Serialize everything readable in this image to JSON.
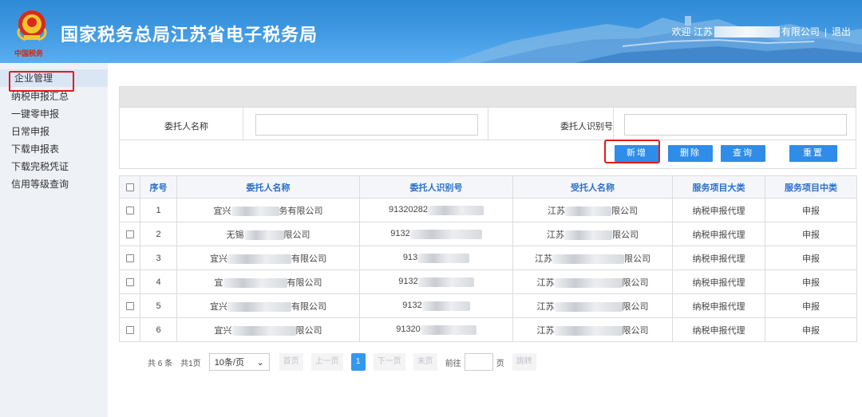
{
  "header": {
    "site_title": "国家税务总局江苏省电子税务局",
    "logo_caption": "中国税务",
    "welcome_prefix": "欢迎 江苏",
    "welcome_suffix": "有限公司",
    "separator": "|",
    "logout_label": "退出",
    "colors": {
      "header_bg": "#3e97e0",
      "accent": "#2f8ce8",
      "highlight": "#e31a1a"
    }
  },
  "sidebar": {
    "items": [
      {
        "label": "企业管理",
        "active": true
      },
      {
        "label": "纳税申报汇总"
      },
      {
        "label": "一键零申报"
      },
      {
        "label": "日常申报"
      },
      {
        "label": "下载申报表"
      },
      {
        "label": "下载完税凭证"
      },
      {
        "label": "信用等级查询"
      }
    ]
  },
  "search": {
    "field1_label": "委托人名称",
    "field1_value": "",
    "field2_label": "委托人识别号",
    "field2_value": ""
  },
  "actions": {
    "add_label": "新增",
    "delete_label": "删除",
    "query_label": "查询",
    "reset_label": "重置"
  },
  "table": {
    "headers": [
      "",
      "序号",
      "委托人名称",
      "委托人识别号",
      "受托人名称",
      "服务项目大类",
      "服务项目中类"
    ],
    "rows": [
      {
        "index": "1",
        "client_pre": "宜兴",
        "client_suf": "务有限公司",
        "id_pre": "91320282",
        "id_suf": "",
        "agent_pre": "江苏",
        "agent_suf": "限公司",
        "category": "纳税申报代理",
        "subcategory": "申报"
      },
      {
        "index": "2",
        "client_pre": "无锡",
        "client_suf": "限公司",
        "id_pre": "9132",
        "id_suf": "",
        "agent_pre": "江苏",
        "agent_suf": "限公司",
        "category": "纳税申报代理",
        "subcategory": "申报"
      },
      {
        "index": "3",
        "client_pre": "宜兴",
        "client_suf": "有限公司",
        "id_pre": "913",
        "id_suf": "",
        "agent_pre": "江苏",
        "agent_suf": "限公司",
        "category": "纳税申报代理",
        "subcategory": "申报"
      },
      {
        "index": "4",
        "client_pre": "宜",
        "client_suf": "有限公司",
        "id_pre": "9132",
        "id_suf": "",
        "agent_pre": "江苏",
        "agent_suf": "限公司",
        "category": "纳税申报代理",
        "subcategory": "申报"
      },
      {
        "index": "5",
        "client_pre": "宜兴",
        "client_suf": "有限公司",
        "id_pre": "9132",
        "id_suf": "",
        "agent_pre": "江苏",
        "agent_suf": "限公司",
        "category": "纳税申报代理",
        "subcategory": "申报"
      },
      {
        "index": "6",
        "client_pre": "宜兴",
        "client_suf": "限公司",
        "id_pre": "91320",
        "id_suf": "",
        "agent_pre": "江苏",
        "agent_suf": "限公司",
        "category": "纳税申报代理",
        "subcategory": "申报"
      }
    ]
  },
  "pager": {
    "total_label": "共 6 条",
    "pages_label": "共1页",
    "page_size": "10条/页",
    "first_label": "首页",
    "prev_label": "上一页",
    "current_page": "1",
    "next_label": "下一页",
    "last_label": "末页",
    "goto_prefix": "前往",
    "goto_suffix": "页",
    "jump_label": "跳转"
  }
}
